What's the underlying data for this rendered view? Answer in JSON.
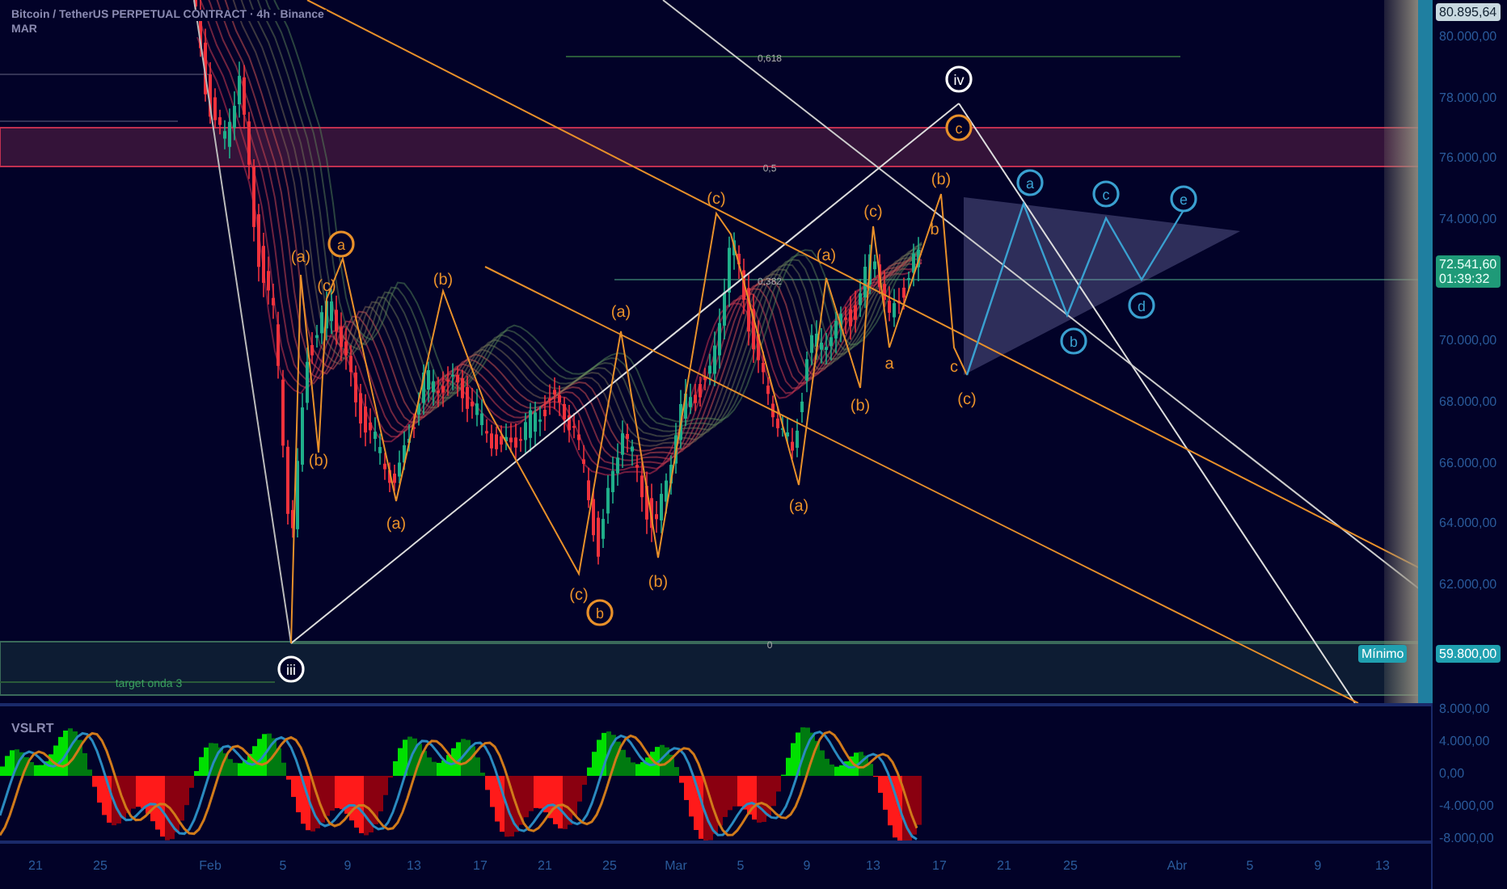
{
  "header": {
    "title": "Bitcoin / TetherUS PERPETUAL CONTRACT · 4h · Binance",
    "subtitle": "MAR"
  },
  "price_axis": {
    "labels": [
      "80.000,00",
      "78.000,00",
      "76.000,00",
      "74.000,00",
      "70.000,00",
      "68.000,00",
      "66.000,00",
      "64.000,00",
      "62.000,00"
    ],
    "high_badge": "80.895,64",
    "current_price": "72.541,60",
    "countdown": "01:39:32",
    "low_badge": {
      "label": "Mínimo",
      "value": "59.800,00"
    }
  },
  "fib_levels": [
    "0,618",
    "0,5",
    "0,382",
    "0"
  ],
  "target_label": "target onda 3",
  "wave_labels": [
    {
      "text": "(a)",
      "kind": "plain",
      "color": "#e8902a"
    },
    {
      "text": "(c)",
      "kind": "plain",
      "color": "#e8902a"
    },
    {
      "text": "(b)",
      "kind": "plain",
      "color": "#e8902a"
    },
    {
      "text": "(a)",
      "kind": "plain",
      "color": "#e8902a"
    },
    {
      "text": "(b)",
      "kind": "plain",
      "color": "#e8902a"
    },
    {
      "text": "(a)",
      "kind": "plain",
      "color": "#e8902a"
    },
    {
      "text": "(c)",
      "kind": "plain",
      "color": "#e8902a"
    },
    {
      "text": "(b)",
      "kind": "plain",
      "color": "#e8902a"
    },
    {
      "text": "(c)",
      "kind": "plain",
      "color": "#e8902a"
    },
    {
      "text": "(a)",
      "kind": "plain",
      "color": "#e8902a"
    },
    {
      "text": "(a)",
      "kind": "plain",
      "color": "#e8902a"
    },
    {
      "text": "(b)",
      "kind": "plain",
      "color": "#e8902a"
    },
    {
      "text": "(c)",
      "kind": "plain",
      "color": "#e8902a"
    },
    {
      "text": "(b)",
      "kind": "plain",
      "color": "#e8902a"
    },
    {
      "text": "b",
      "kind": "plain",
      "color": "#e8902a"
    },
    {
      "text": "a",
      "kind": "plain",
      "color": "#e8902a"
    },
    {
      "text": "c",
      "kind": "plain",
      "color": "#e8902a"
    },
    {
      "text": "(c)",
      "kind": "plain",
      "color": "#e8902a"
    },
    {
      "text": "a",
      "kind": "circled",
      "color": "#e8902a"
    },
    {
      "text": "b",
      "kind": "circled",
      "color": "#e8902a"
    },
    {
      "text": "iv",
      "kind": "circled",
      "color": "#ffffff"
    },
    {
      "text": "c",
      "kind": "circled",
      "color": "#e8902a"
    },
    {
      "text": "iii",
      "kind": "circled",
      "color": "#ffffff"
    },
    {
      "text": "a",
      "kind": "circled",
      "color": "#3aa0d0"
    },
    {
      "text": "b",
      "kind": "circled",
      "color": "#3aa0d0"
    },
    {
      "text": "c",
      "kind": "circled",
      "color": "#3aa0d0"
    },
    {
      "text": "d",
      "kind": "circled",
      "color": "#3aa0d0"
    },
    {
      "text": "e",
      "kind": "circled",
      "color": "#3aa0d0"
    }
  ],
  "oscillator": {
    "name": "VSLRT",
    "axis_labels": [
      "8.000,00",
      "4.000,00",
      "0,00",
      "-4.000,00",
      "-8.000,00"
    ]
  },
  "time_axis": [
    "21",
    "25",
    "Feb",
    "5",
    "9",
    "13",
    "17",
    "21",
    "25",
    "Mar",
    "5",
    "9",
    "13",
    "17",
    "21",
    "25",
    "Abr",
    "5",
    "9",
    "13"
  ]
}
